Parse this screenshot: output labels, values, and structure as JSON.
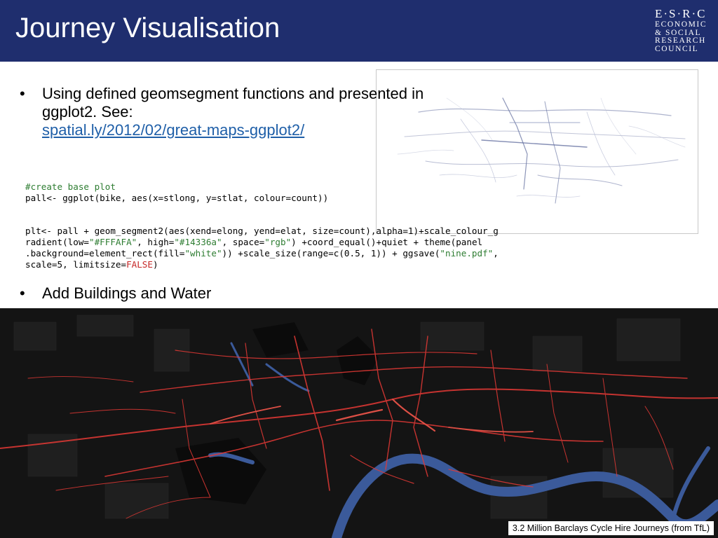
{
  "slide": {
    "title": "Journey Visualisation",
    "logo": {
      "line1": "E·S·R·C",
      "lines": [
        "ECONOMIC",
        "& SOCIAL",
        "RESEARCH",
        "COUNCIL"
      ]
    },
    "bullets": [
      {
        "marker": "•",
        "text": "Using defined geomsegment functions and presented in ggplot2. See:",
        "link": "spatial.ly/2012/02/great-maps-ggplot2/"
      },
      {
        "marker": "•",
        "text": "Add Buildings and Water"
      }
    ],
    "code": {
      "comment": "#create base plot",
      "line_pall": "pall<- ggplot(bike, aes(x=stlong, y=stlat, colour=count))",
      "plt_line1_a": "plt<- pall + geom_segment2(aes(xend=elong, yend=elat, size=count),alpha=1)+scale_colour_g",
      "plt_line2_a": "radient(low=",
      "plt_line2_low": "\"#FFFAFA\"",
      "plt_line2_b": ", high=",
      "plt_line2_high": "\"#14336a\"",
      "plt_line2_c": ", space=",
      "plt_line2_space": "\"rgb\"",
      "plt_line2_d": ") +coord_equal()+quiet + theme(panel",
      "plt_line3_a": ".background=element_rect(fill=",
      "plt_line3_fill": "\"white\"",
      "plt_line3_b": ")) +scale_size(range=c(0.5, 1)) + ggsave(",
      "plt_line3_file": "\"nine.pdf\"",
      "plt_line3_c": ",",
      "plt_line4_a": "scale=5, limitsize=",
      "plt_line4_false": "FALSE",
      "plt_line4_b": ")"
    },
    "map_caption": "3.2 Million Barclays Cycle Hire Journeys (from TfL)",
    "colors": {
      "header": "#1f2e6e",
      "link": "#1f5fa8",
      "route": "#e53935",
      "water": "#3b5a9a",
      "map_bg": "#141414"
    }
  }
}
